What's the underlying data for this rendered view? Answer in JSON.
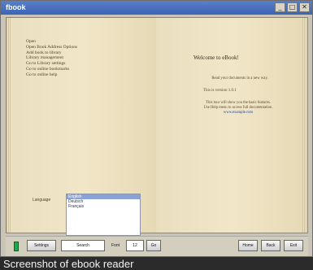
{
  "window": {
    "title": "fbook",
    "buttons": {
      "minimize": "_",
      "maximize": "□",
      "close": "✕"
    }
  },
  "book": {
    "left_menu": [
      "Open",
      "Open Book Address Options",
      "Add book to library",
      "Library management",
      "Go to Library settings",
      "Go to online bookmarks",
      "Go to online help"
    ],
    "language_label": "Language",
    "languages": [
      "English",
      "Deutsch",
      "Français"
    ],
    "right_title": "Welcome to eBook!",
    "right_intro": "Read your documents in a new way.",
    "version": "This is version 1.0.1",
    "tour_lines": [
      "This tour will show you the basic features.",
      "Use Help menu to access full documentation.",
      "www.example.com"
    ]
  },
  "toolbar": {
    "settings": "Settings",
    "search_value": "Search",
    "font_label": "Font",
    "font_value": "12",
    "go": "Go",
    "home": "Home",
    "back": "Back",
    "exit": "Exit"
  },
  "caption": "Screenshot of ebook reader"
}
